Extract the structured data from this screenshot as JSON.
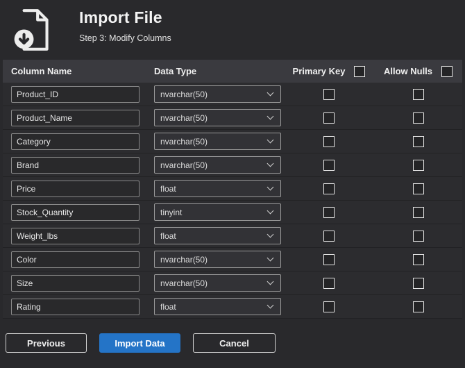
{
  "header": {
    "title": "Import File",
    "subtitle": "Step 3: Modify Columns",
    "icon": "import-file-icon"
  },
  "table": {
    "headers": {
      "column_name": "Column Name",
      "data_type": "Data Type",
      "primary_key": "Primary Key",
      "allow_nulls": "Allow Nulls"
    },
    "header_checkboxes": {
      "primary_key_checked": false,
      "allow_nulls_checked": false
    },
    "rows": [
      {
        "name": "Product_ID",
        "type": "nvarchar(50)",
        "primary_key": false,
        "allow_nulls": false
      },
      {
        "name": "Product_Name",
        "type": "nvarchar(50)",
        "primary_key": false,
        "allow_nulls": false
      },
      {
        "name": "Category",
        "type": "nvarchar(50)",
        "primary_key": false,
        "allow_nulls": false
      },
      {
        "name": "Brand",
        "type": "nvarchar(50)",
        "primary_key": false,
        "allow_nulls": false
      },
      {
        "name": "Price",
        "type": "float",
        "primary_key": false,
        "allow_nulls": false
      },
      {
        "name": "Stock_Quantity",
        "type": "tinyint",
        "primary_key": false,
        "allow_nulls": false
      },
      {
        "name": "Weight_lbs",
        "type": "float",
        "primary_key": false,
        "allow_nulls": false
      },
      {
        "name": "Color",
        "type": "nvarchar(50)",
        "primary_key": false,
        "allow_nulls": false
      },
      {
        "name": "Size",
        "type": "nvarchar(50)",
        "primary_key": false,
        "allow_nulls": false
      },
      {
        "name": "Rating",
        "type": "float",
        "primary_key": false,
        "allow_nulls": false
      }
    ]
  },
  "buttons": {
    "previous": "Previous",
    "import": "Import Data",
    "cancel": "Cancel"
  },
  "colors": {
    "accent": "#2474c7",
    "background": "#29292c",
    "table_header": "#3a3a3f"
  }
}
